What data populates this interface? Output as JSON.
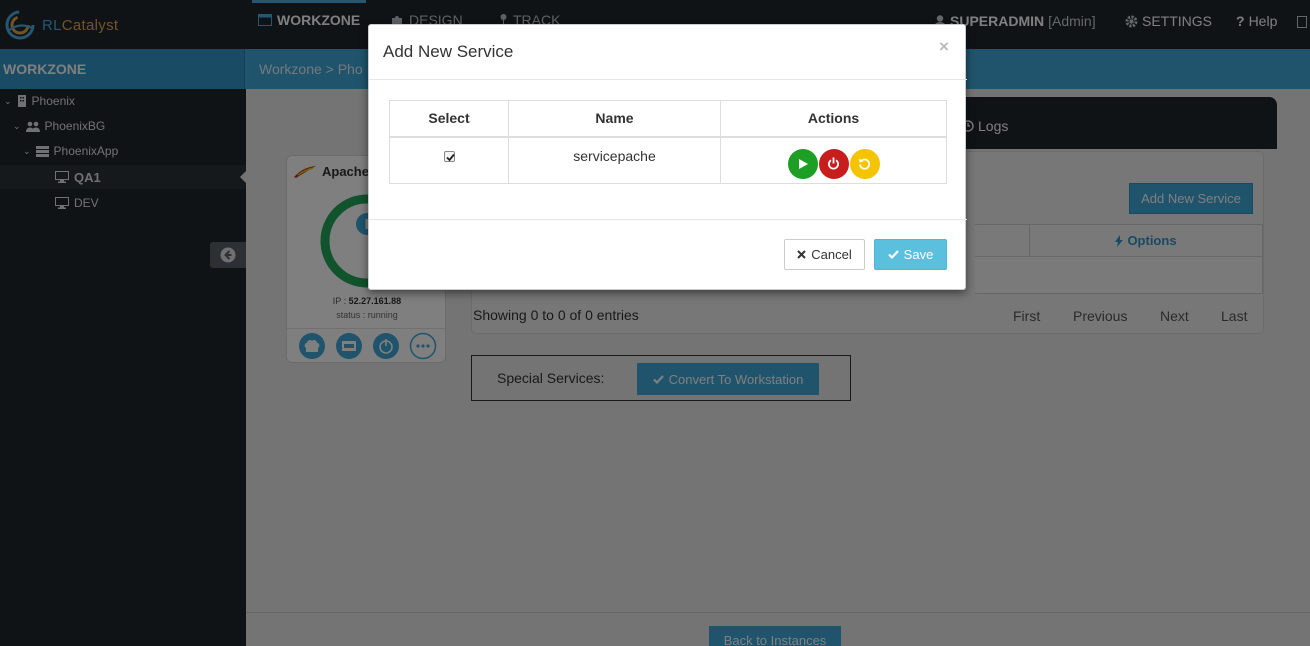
{
  "app": {
    "logo_prefix": "RL",
    "logo_suffix": "Catalyst"
  },
  "topnav": {
    "items": [
      {
        "label": "WORKZONE",
        "icon": "workzone-icon"
      },
      {
        "label": "DESIGN",
        "icon": "puzzle-icon"
      },
      {
        "label": "TRACK",
        "icon": "pin-icon"
      }
    ],
    "user": "SUPERADMIN",
    "role": "[Admin]",
    "settings": "SETTINGS",
    "help": "Help"
  },
  "secbar": {
    "title": "WORKZONE",
    "breadcrumb": "Workzone > Pho"
  },
  "sidebar": {
    "tree": [
      {
        "label": "Phoenix",
        "icon": "building-icon"
      },
      {
        "label": "PhoenixBG",
        "icon": "group-icon"
      },
      {
        "label": "PhoenixApp",
        "icon": "server-icon"
      },
      {
        "label": "QA1",
        "icon": "monitor-icon"
      },
      {
        "label": "DEV",
        "icon": "monitor-icon"
      }
    ]
  },
  "main": {
    "tab_logs": "Logs",
    "add_new_service": "Add New Service",
    "options_header": "Options",
    "showing": "Showing 0 to 0 of 0 entries",
    "pagination": [
      "First",
      "Previous",
      "Next",
      "Last"
    ],
    "special_services_label": "Special Services:",
    "convert_button": "Convert To Workstation",
    "back_button": "Back to Instances"
  },
  "instance_card": {
    "name": "Apache",
    "ip_label": "IP :",
    "ip": "52.27.161.88",
    "status": "status : running",
    "colors": {
      "ring": "#22a65a",
      "info": "#3ea8d9"
    }
  },
  "modal": {
    "title": "Add New Service",
    "close": "×",
    "columns": [
      "Select",
      "Name",
      "Actions"
    ],
    "rows": [
      {
        "checked": true,
        "name": "servicepache"
      }
    ],
    "action_colors": {
      "start": "#1d9e24",
      "stop": "#c81d1d",
      "restart": "#f5c400"
    },
    "cancel": "Cancel",
    "save": "Save"
  }
}
